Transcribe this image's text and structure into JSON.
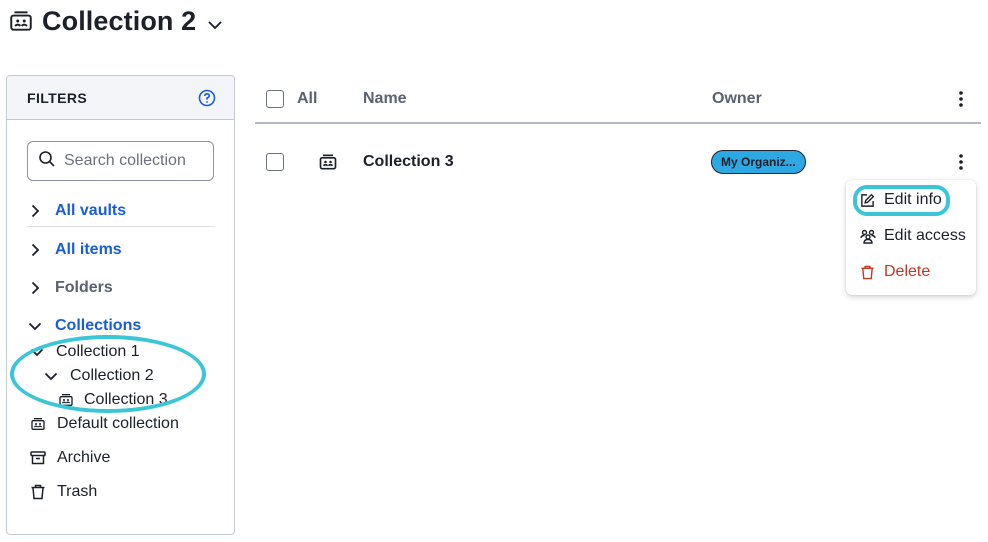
{
  "header": {
    "title": "Collection 2",
    "icon": "collection-icon",
    "dropdown_icon": "chevron-down-icon"
  },
  "filters": {
    "heading": "FILTERS",
    "help_icon": "question-circle-icon",
    "search": {
      "placeholder": "Search collection",
      "value": ""
    },
    "vaults_label": "All vaults",
    "items_label": "All items",
    "folders_label": "Folders",
    "collections_label": "Collections",
    "tree": [
      {
        "label": "Collection 1",
        "expanded": true
      },
      {
        "label": "Collection 2",
        "expanded": true
      },
      {
        "label": "Collection 3"
      }
    ],
    "default_collection_label": "Default collection",
    "archive_label": "Archive",
    "trash_label": "Trash"
  },
  "table": {
    "columns": {
      "all": "All",
      "name": "Name",
      "owner": "Owner"
    },
    "rows": [
      {
        "name": "Collection 3",
        "owner": "My Organiz...",
        "icon": "collection-icon"
      }
    ]
  },
  "row_menu": {
    "items": [
      {
        "label": "Edit info",
        "icon": "edit-icon"
      },
      {
        "label": "Edit access",
        "icon": "users-icon"
      },
      {
        "label": "Delete",
        "icon": "trash-icon"
      }
    ]
  },
  "colors": {
    "link": "#175ddc",
    "badge": "#2ea8e2",
    "danger": "#c83522",
    "highlight_ring": "#3ac6d6"
  }
}
